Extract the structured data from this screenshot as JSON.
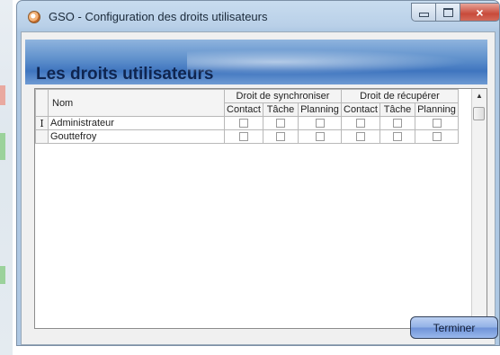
{
  "window": {
    "title": "GSO - Configuration des droits utilisateurs",
    "close_label": "×"
  },
  "banner": {
    "title": "Les droits utilisateurs"
  },
  "grid": {
    "name_header": "Nom",
    "group_sync": "Droit de synchroniser",
    "group_recover": "Droit de récupérer",
    "sub_headers": [
      "Contact",
      "Tâche",
      "Planning",
      "Contact",
      "Tâche",
      "Planning"
    ],
    "current_row_marker": "I",
    "rows": [
      {
        "name": "Administrateur",
        "current": true,
        "checks": [
          false,
          false,
          false,
          false,
          false,
          false
        ]
      },
      {
        "name": "Gouttefroy",
        "current": false,
        "checks": [
          false,
          false,
          false,
          false,
          false,
          false
        ]
      }
    ]
  },
  "scrollbar": {
    "up_arrow": "▲",
    "down_arrow": "▼"
  },
  "footer": {
    "button_label": "Terminer"
  }
}
